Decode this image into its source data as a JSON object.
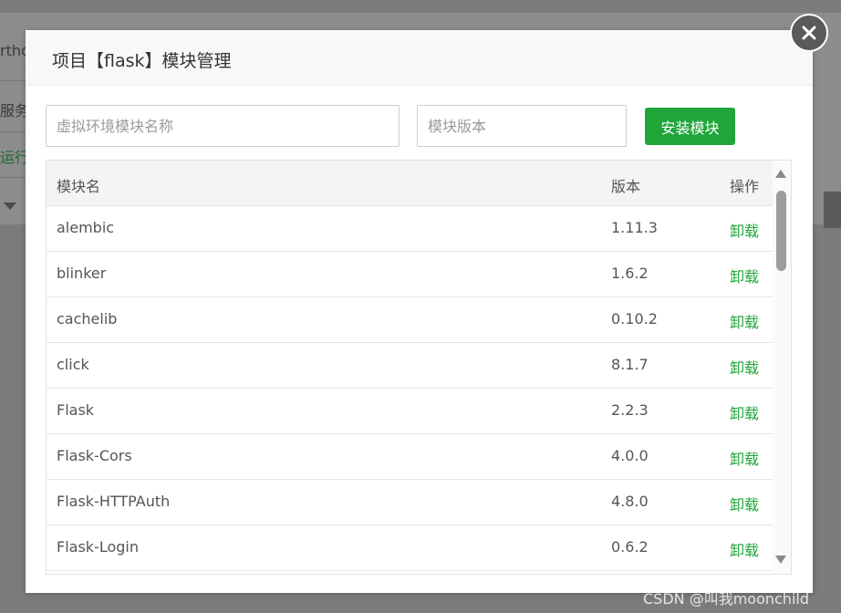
{
  "background": {
    "fragments": [
      "rtho",
      "服务",
      "运行"
    ]
  },
  "modal": {
    "title": "项目【flask】模块管理",
    "close_icon": "close-icon",
    "module_name_placeholder": "虚拟环境模块名称",
    "module_version_placeholder": "模块版本",
    "install_label": "安装模块"
  },
  "table": {
    "headers": {
      "name": "模块名",
      "version": "版本",
      "action": "操作"
    },
    "rows": [
      {
        "name": "alembic",
        "version": "1.11.3",
        "action": "卸载"
      },
      {
        "name": "blinker",
        "version": "1.6.2",
        "action": "卸载"
      },
      {
        "name": "cachelib",
        "version": "0.10.2",
        "action": "卸载"
      },
      {
        "name": "click",
        "version": "8.1.7",
        "action": "卸载"
      },
      {
        "name": "Flask",
        "version": "2.2.3",
        "action": "卸载"
      },
      {
        "name": "Flask-Cors",
        "version": "4.0.0",
        "action": "卸载"
      },
      {
        "name": "Flask-HTTPAuth",
        "version": "4.8.0",
        "action": "卸载"
      },
      {
        "name": "Flask-Login",
        "version": "0.6.2",
        "action": "卸载"
      }
    ]
  },
  "watermark": "CSDN @叫我moonchild",
  "colors": {
    "accent": "#20a53a"
  }
}
